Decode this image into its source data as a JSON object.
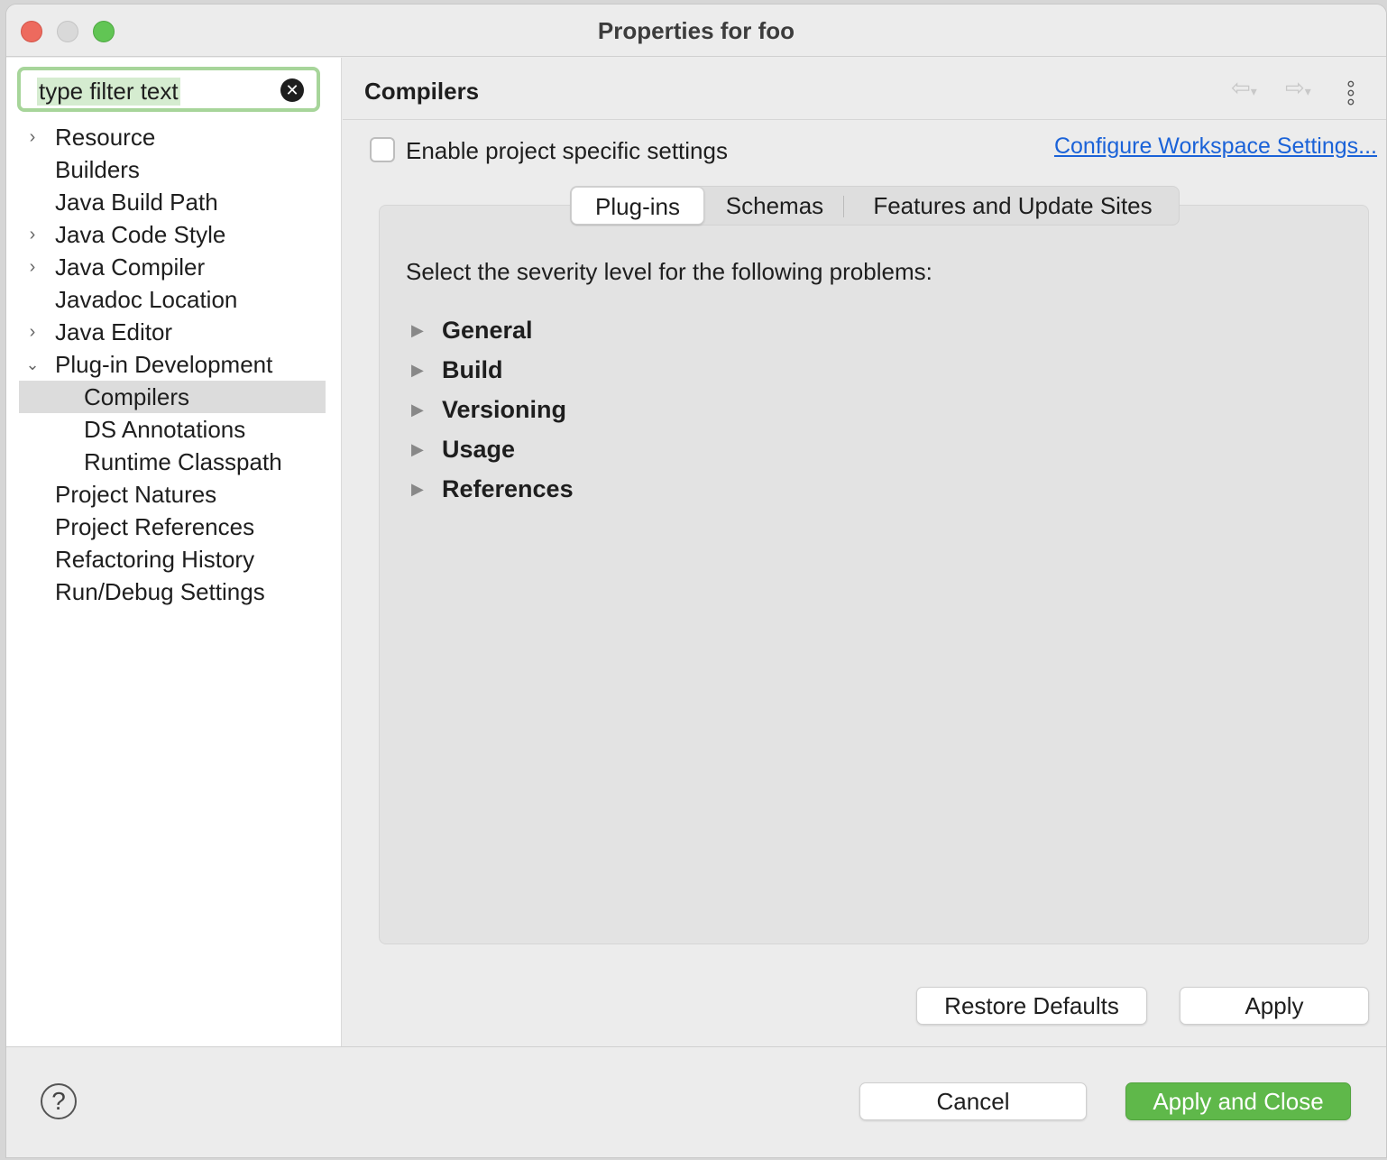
{
  "window": {
    "title": "Properties for foo"
  },
  "sidebar": {
    "filter_placeholder": "type filter text",
    "items": [
      {
        "label": "Resource",
        "expandable": true,
        "expanded": false,
        "level": 0
      },
      {
        "label": "Builders",
        "expandable": false,
        "level": 0
      },
      {
        "label": "Java Build Path",
        "expandable": false,
        "level": 0
      },
      {
        "label": "Java Code Style",
        "expandable": true,
        "expanded": false,
        "level": 0
      },
      {
        "label": "Java Compiler",
        "expandable": true,
        "expanded": false,
        "level": 0
      },
      {
        "label": "Javadoc Location",
        "expandable": false,
        "level": 0
      },
      {
        "label": "Java Editor",
        "expandable": true,
        "expanded": false,
        "level": 0
      },
      {
        "label": "Plug-in Development",
        "expandable": true,
        "expanded": true,
        "level": 0
      },
      {
        "label": "Compilers",
        "expandable": false,
        "level": 1,
        "selected": true
      },
      {
        "label": "DS Annotations",
        "expandable": false,
        "level": 1
      },
      {
        "label": "Runtime Classpath",
        "expandable": false,
        "level": 1
      },
      {
        "label": "Project Natures",
        "expandable": false,
        "level": 0
      },
      {
        "label": "Project References",
        "expandable": false,
        "level": 0
      },
      {
        "label": "Refactoring History",
        "expandable": false,
        "level": 0
      },
      {
        "label": "Run/Debug Settings",
        "expandable": false,
        "level": 0
      }
    ]
  },
  "page": {
    "title": "Compilers",
    "enable_label": "Enable project specific settings",
    "enable_checked": false,
    "configure_link": "Configure Workspace Settings...",
    "tabs": [
      "Plug-ins",
      "Schemas",
      "Features and Update Sites"
    ],
    "active_tab": "Plug-ins",
    "severity_prompt": "Select the severity level for the following problems:",
    "groups": [
      "General",
      "Build",
      "Versioning",
      "Usage",
      "References"
    ]
  },
  "buttons": {
    "restore_defaults": "Restore Defaults",
    "apply": "Apply",
    "cancel": "Cancel",
    "apply_and_close": "Apply and Close"
  },
  "icons": {
    "help": "help-icon",
    "back": "back-arrow-icon",
    "forward": "forward-arrow-icon",
    "menu": "vertical-ellipsis-icon",
    "clear": "clear-icon"
  },
  "colors": {
    "link": "#1a62d8",
    "primary_button": "#5fb84a",
    "filter_focus": "#a7d59a"
  }
}
